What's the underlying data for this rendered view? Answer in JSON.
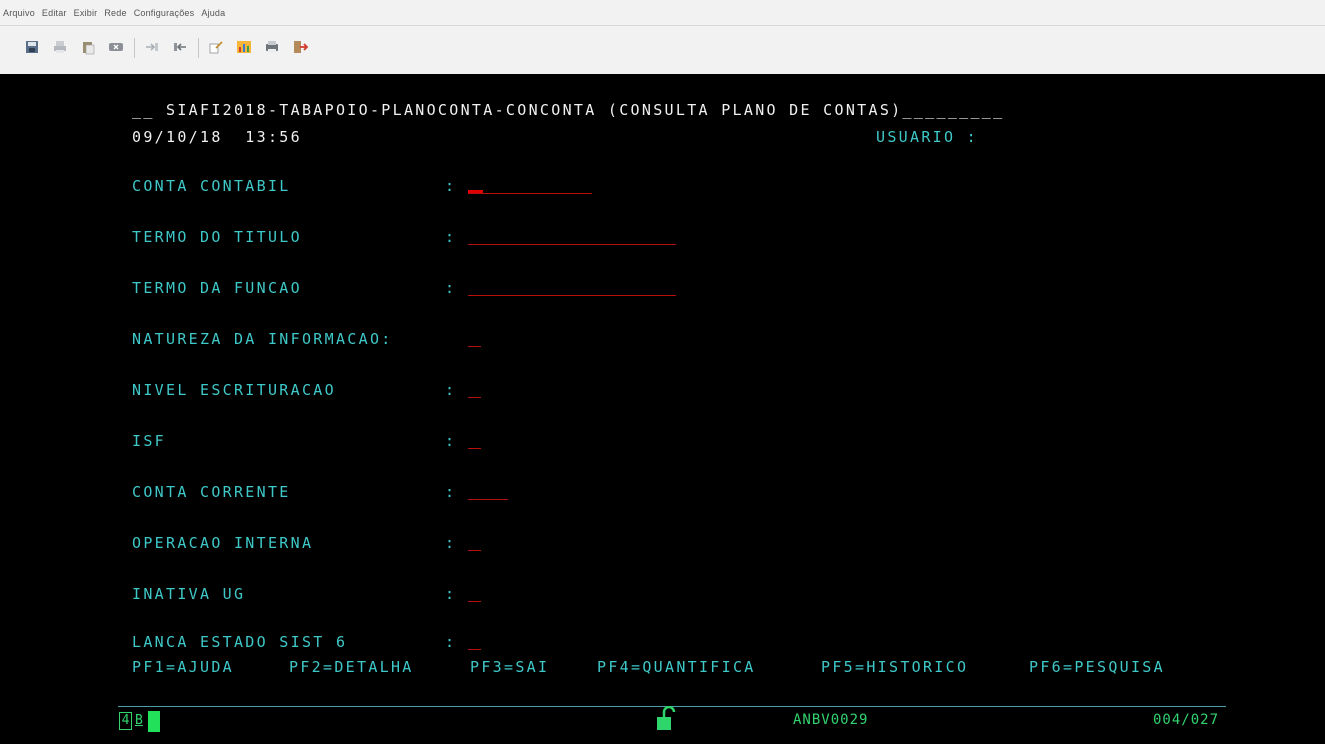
{
  "menu": [
    "Arquivo",
    "Editar",
    "Exibir",
    "Rede",
    "Configurações",
    "Ajuda"
  ],
  "toolbar_icons": [
    "save-icon",
    "print-icon",
    "paste-icon",
    "clear-icon",
    "send-icon",
    "receive-icon",
    "edit-icon",
    "chart-icon",
    "printer-icon",
    "exit-icon"
  ],
  "screen": {
    "title_line": "__ SIAFI2018-TABAPOIO-PLANOCONTA-CONCONTA (CONSULTA PLANO DE CONTAS)_________",
    "datetime": "09/10/18  13:56",
    "usuario_label": "USUARIO :",
    "fields": [
      {
        "label": "CONTA CONTABIL",
        "colon": ":"
      },
      {
        "label": "TERMO DO TITULO",
        "colon": ":"
      },
      {
        "label": "TERMO DA FUNCAO",
        "colon": ":"
      },
      {
        "label": "NATUREZA DA INFORMACAO:",
        "colon": ""
      },
      {
        "label": "NIVEL ESCRITURACAO",
        "colon": ":"
      },
      {
        "label": "ISF",
        "colon": ":"
      },
      {
        "label": "CONTA CORRENTE",
        "colon": ":"
      },
      {
        "label": "OPERACAO INTERNA",
        "colon": ":"
      },
      {
        "label": "INATIVA UG",
        "colon": ":"
      },
      {
        "label": "LANCA ESTADO SIST 6",
        "colon": ":"
      }
    ],
    "pf_keys": [
      "PF1=AJUDA",
      "PF2=DETALHA",
      "PF3=SAI",
      "PF4=QUANTIFICA",
      "PF5=HISTORICO",
      "PF6=PESQUISA"
    ]
  },
  "status": {
    "indicator_a": "4",
    "indicator_b": "B",
    "terminal_id": "ANBV0029",
    "cursor_pos": "004/027",
    "lock_icon": "unlock-icon"
  },
  "colors": {
    "background": "#000000",
    "label": "#3fc8c8",
    "field_underline": "#b50f0f",
    "status": "#33d36f"
  }
}
